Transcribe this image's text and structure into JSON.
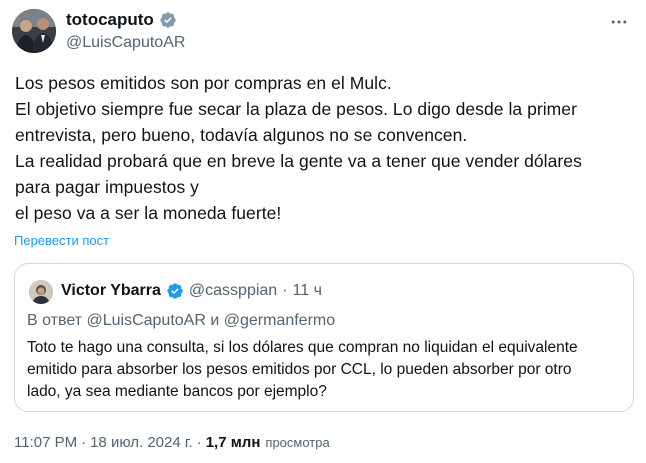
{
  "author": {
    "display_name": "totocaputo",
    "handle": "@LuisCaputoAR",
    "verified": true,
    "verified_color": "#829aab"
  },
  "tweet": {
    "lines": [
      "Los pesos emitidos son por compras en el Mulc.",
      "El objetivo siempre fue secar la plaza de pesos. Lo digo desde la primer",
      "entrevista, pero bueno, todavía algunos no se convencen.",
      "La realidad probará que en breve la gente va a tener que vender dólares",
      "para pagar impuestos y",
      "el peso va a ser la moneda fuerte!"
    ],
    "translate_label": "Перевести пост"
  },
  "quote": {
    "display_name": "Victor Ybarra",
    "verified": true,
    "verified_color": "#1d9bf0",
    "handle": "@cassppian",
    "dot": "·",
    "time": "11 ч",
    "reply_prefix": "В ответ",
    "reply_mention_1": "@LuisCaputoAR",
    "reply_and": "и",
    "reply_mention_2": "@germanfermo",
    "lines": [
      "Toto te hago una consulta, si los dólares que compran no liquidan el equivalente",
      "emitido para absorber los pesos emitidos por CCL, lo pueden absorber por otro",
      "lado, ya sea mediante bancos por ejemplo?"
    ]
  },
  "meta": {
    "time": "11:07 PM",
    "dot1": "·",
    "date": "18 июл. 2024 г.",
    "dot2": "·",
    "views_count": "1,7 млн",
    "views_label": "просмотра"
  },
  "icons": {
    "more": "more-horizontal-icon",
    "verified": "verified-badge-icon"
  },
  "colors": {
    "text": "#0f1419",
    "secondary": "#536471",
    "link": "#1d9bf0",
    "border": "#cfd9de"
  }
}
